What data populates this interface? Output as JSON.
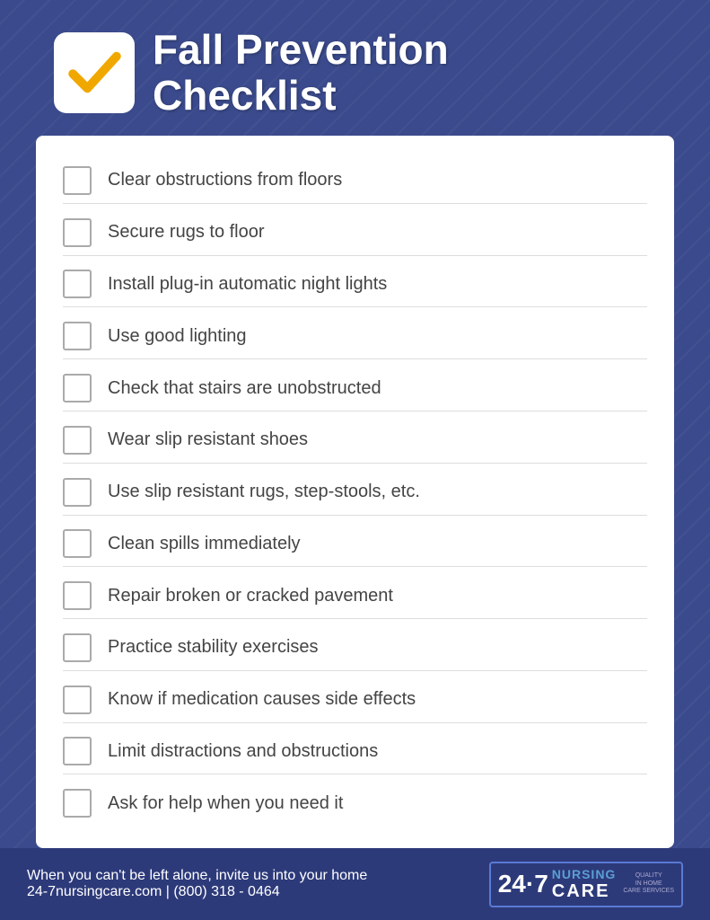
{
  "header": {
    "title_line1": "Fall Prevention",
    "title_line2": "Checklist"
  },
  "checklist": {
    "items": [
      "Clear obstructions from floors",
      "Secure rugs to floor",
      "Install plug-in automatic night lights",
      "Use good lighting",
      "Check that stairs are unobstructed",
      "Wear slip resistant shoes",
      "Use slip resistant rugs, step-stools, etc.",
      "Clean spills immediately",
      "Repair broken or cracked pavement",
      "Practice stability exercises",
      "Know if medication causes side effects",
      "Limit distractions and obstructions",
      "Ask for help when you need it"
    ]
  },
  "footer": {
    "tagline": "When you can't be left alone, invite us into your home",
    "contact": "24-7nursingcare.com | (800) 318 - 0464",
    "logo_247": "24·7",
    "logo_nursing": "NURSING",
    "logo_care": "CARE",
    "logo_badge_line1": "QUALITY",
    "logo_badge_line2": "IN HOME",
    "logo_badge_line3": "CARE SERVICES"
  }
}
